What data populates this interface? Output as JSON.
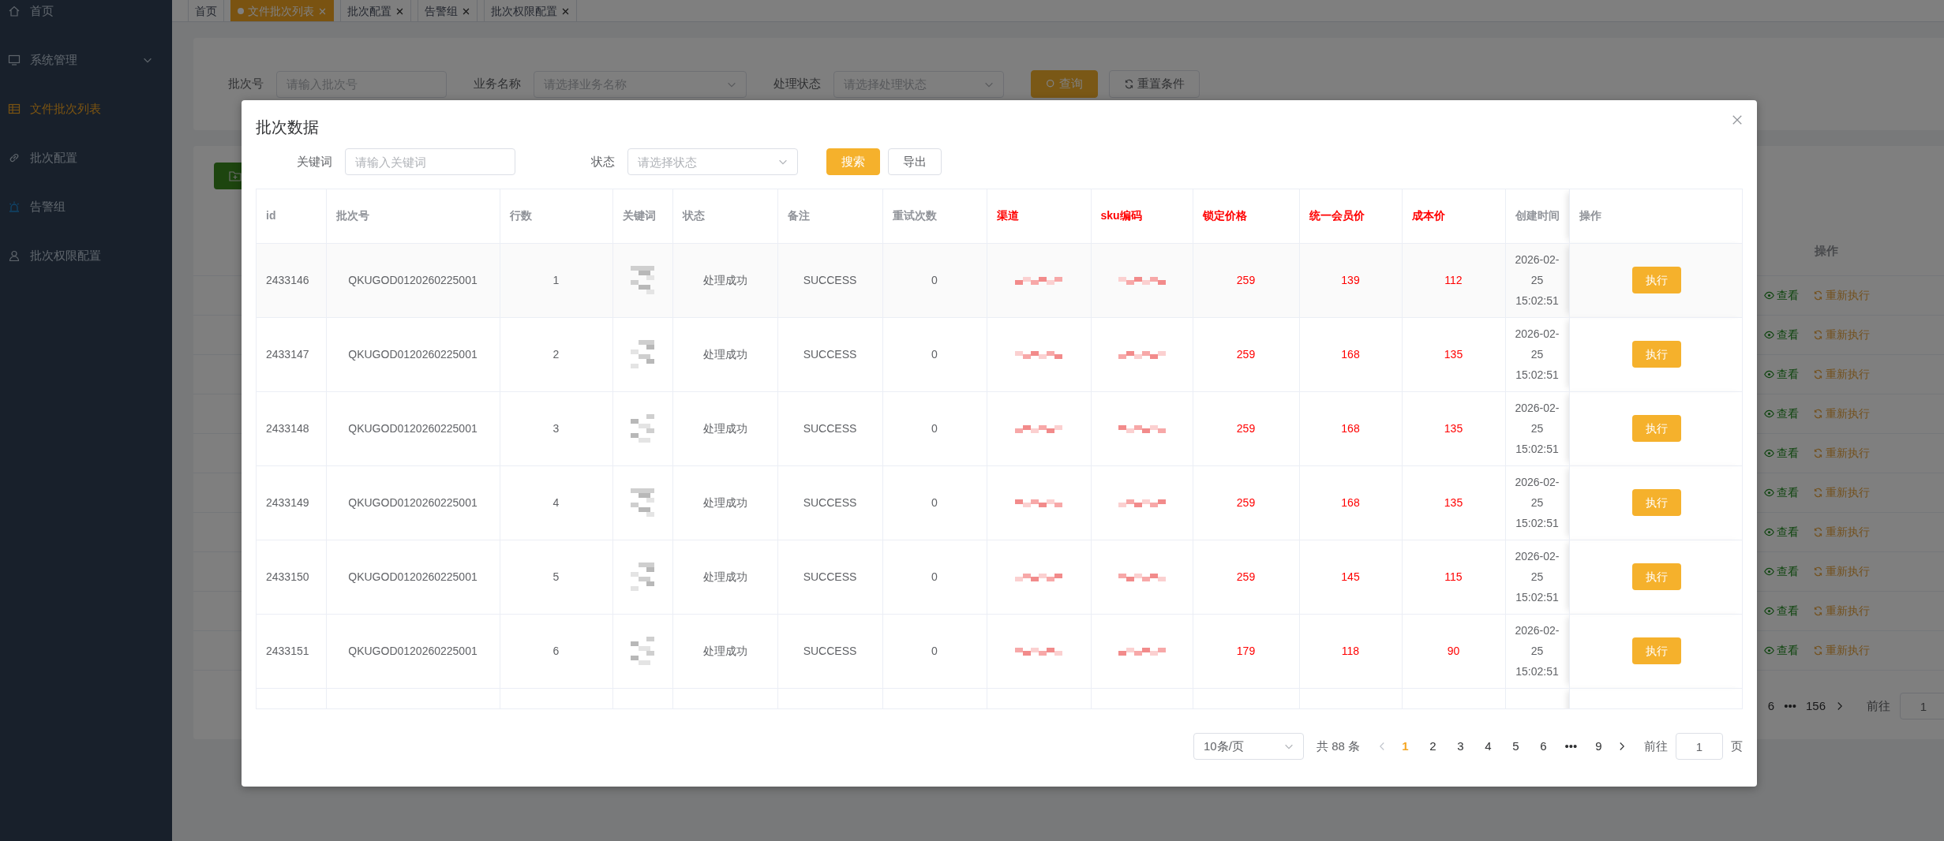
{
  "sidebar": {
    "items": [
      {
        "label": "首页",
        "selected": false,
        "kind": "link"
      },
      {
        "label": "系统管理",
        "selected": false,
        "kind": "group"
      },
      {
        "label": "文件批次列表",
        "selected": true,
        "kind": "link"
      },
      {
        "label": "批次配置",
        "selected": false,
        "kind": "link"
      },
      {
        "label": "告警组",
        "selected": false,
        "kind": "link"
      },
      {
        "label": "批次权限配置",
        "selected": false,
        "kind": "link"
      }
    ]
  },
  "tabs": [
    {
      "label": "首页",
      "selected": false,
      "closable": false
    },
    {
      "label": "文件批次列表",
      "selected": true,
      "closable": true
    },
    {
      "label": "批次配置",
      "selected": false,
      "closable": true
    },
    {
      "label": "告警组",
      "selected": false,
      "closable": true
    },
    {
      "label": "批次权限配置",
      "selected": false,
      "closable": true
    }
  ],
  "filter": {
    "fields": [
      {
        "label": "批次号",
        "placeholder": "请输入批次号",
        "kind": "input"
      },
      {
        "label": "业务名称",
        "placeholder": "请选择业务名称",
        "kind": "select"
      },
      {
        "label": "处理状态",
        "placeholder": "请选择处理状态",
        "kind": "select"
      }
    ],
    "buttons": [
      {
        "label": "查询",
        "kind": "primary"
      },
      {
        "label": "重置条件",
        "kind": "default"
      }
    ]
  },
  "batch_table": {
    "action_header": "操作",
    "rows": [
      {
        "view": "查看",
        "rerun": "重新执行"
      },
      {
        "view": "查看",
        "rerun": "重新执行"
      },
      {
        "view": "查看",
        "rerun": "重新执行"
      },
      {
        "view": "查看",
        "rerun": "重新执行"
      },
      {
        "view": "查看",
        "rerun": "重新执行"
      },
      {
        "view": "查看",
        "rerun": "重新执行"
      },
      {
        "view": "查看",
        "rerun": "重新执行"
      },
      {
        "view": "查看",
        "rerun": "重新执行"
      },
      {
        "view": "查看",
        "rerun": "重新执行"
      },
      {
        "view": "查看",
        "rerun": "重新执行"
      }
    ],
    "pagination": {
      "pages": [
        "6",
        "•••",
        "156"
      ],
      "goto_label": "前往",
      "goto_value": "1"
    }
  },
  "modal": {
    "title": "批次数据",
    "filters": [
      {
        "label": "关键词",
        "placeholder": "请输入关键词",
        "kind": "input"
      },
      {
        "label": "状态",
        "placeholder": "请选择状态",
        "kind": "select"
      }
    ],
    "buttons": [
      {
        "label": "搜索",
        "kind": "primary"
      },
      {
        "label": "导出",
        "kind": "default"
      }
    ],
    "table": {
      "columns": [
        {
          "label": "id",
          "highlight": false,
          "kind": "text"
        },
        {
          "label": "批次号",
          "highlight": false,
          "kind": "text"
        },
        {
          "label": "行数",
          "highlight": false,
          "kind": "text"
        },
        {
          "label": "关键词",
          "highlight": false,
          "kind": "redacted"
        },
        {
          "label": "状态",
          "highlight": false,
          "kind": "text"
        },
        {
          "label": "备注",
          "highlight": false,
          "kind": "text"
        },
        {
          "label": "重试次数",
          "highlight": false,
          "kind": "text"
        },
        {
          "label": "渠道",
          "highlight": true,
          "kind": "redacted"
        },
        {
          "label": "sku编码",
          "highlight": true,
          "kind": "redacted"
        },
        {
          "label": "锁定价格",
          "highlight": true,
          "kind": "text"
        },
        {
          "label": "统一会员价",
          "highlight": true,
          "kind": "text"
        },
        {
          "label": "成本价",
          "highlight": true,
          "kind": "text"
        },
        {
          "label": "创建时间",
          "highlight": false,
          "kind": "text"
        },
        {
          "label": "操作",
          "highlight": false,
          "kind": "action"
        }
      ],
      "rows": [
        {
          "cells": [
            "2433146",
            "QKUGOD0120260225001",
            "1",
            "",
            "处理成功",
            "SUCCESS",
            "0",
            "",
            "",
            "259",
            "139",
            "112",
            "2026-02-25 15:02:51",
            "执行"
          ]
        },
        {
          "cells": [
            "2433147",
            "QKUGOD0120260225001",
            "2",
            "",
            "处理成功",
            "SUCCESS",
            "0",
            "",
            "",
            "259",
            "168",
            "135",
            "2026-02-25 15:02:51",
            "执行"
          ]
        },
        {
          "cells": [
            "2433148",
            "QKUGOD0120260225001",
            "3",
            "",
            "处理成功",
            "SUCCESS",
            "0",
            "",
            "",
            "259",
            "168",
            "135",
            "2026-02-25 15:02:51",
            "执行"
          ]
        },
        {
          "cells": [
            "2433149",
            "QKUGOD0120260225001",
            "4",
            "",
            "处理成功",
            "SUCCESS",
            "0",
            "",
            "",
            "259",
            "168",
            "135",
            "2026-02-25 15:02:51",
            "执行"
          ]
        },
        {
          "cells": [
            "2433150",
            "QKUGOD0120260225001",
            "5",
            "",
            "处理成功",
            "SUCCESS",
            "0",
            "",
            "",
            "259",
            "145",
            "115",
            "2026-02-25 15:02:51",
            "执行"
          ]
        },
        {
          "cells": [
            "2433151",
            "QKUGOD0120260225001",
            "6",
            "",
            "处理成功",
            "SUCCESS",
            "0",
            "",
            "",
            "179",
            "118",
            "90",
            "2026-02-25 15:02:51",
            "执行"
          ]
        }
      ]
    },
    "pagination": {
      "page_size": "10条/页",
      "total": "共 88 条",
      "pages": [
        {
          "label": "1",
          "selected": true
        },
        {
          "label": "2",
          "selected": false
        },
        {
          "label": "3",
          "selected": false
        },
        {
          "label": "4",
          "selected": false
        },
        {
          "label": "5",
          "selected": false
        },
        {
          "label": "6",
          "selected": false
        },
        {
          "label": "•••",
          "selected": false
        },
        {
          "label": "9",
          "selected": false
        }
      ],
      "goto_label": "前往",
      "goto_value": "1",
      "page_unit": "页"
    }
  }
}
